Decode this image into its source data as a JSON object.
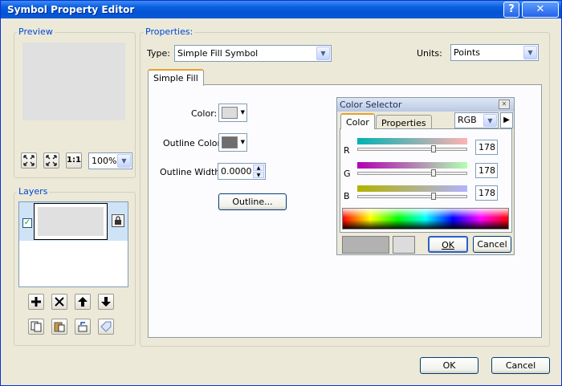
{
  "window": {
    "title": "Symbol Property Editor",
    "help_label": "?",
    "close_label": "✕"
  },
  "preview": {
    "label": "Preview",
    "zoom_value": "100%",
    "swatch_color": "#e0e0e0",
    "icons": [
      "fit-icon",
      "full-extent-icon",
      "actual-size-icon"
    ]
  },
  "layers": {
    "label": "Layers",
    "checked": true,
    "layer_fill": "#e0e0e0",
    "icons_row1": [
      "add-layer-icon",
      "remove-layer-icon",
      "move-up-icon",
      "move-down-icon"
    ],
    "icons_row2": [
      "copy-icon",
      "paste-icon",
      "reset-icon",
      "tag-icon"
    ]
  },
  "properties": {
    "label": "Properties:",
    "type_label": "Type:",
    "type_value": "Simple Fill Symbol",
    "units_label": "Units:",
    "units_value": "Points",
    "tab_label": "Simple Fill",
    "color_label": "Color:",
    "color_value": "#dcdcdc",
    "outline_color_label": "Outline Color:",
    "outline_color_value": "#6e6e6e",
    "outline_width_label": "Outline Width:",
    "outline_width_value": "0.0000",
    "outline_button": "Outline..."
  },
  "color_selector": {
    "title": "Color Selector",
    "tabs": [
      "Color",
      "Properties"
    ],
    "model": "RGB",
    "channels": [
      {
        "name": "R",
        "value": "178",
        "level": 0.7,
        "gradient": "linear-gradient(to right, #00b2b2, #ffb2b2)"
      },
      {
        "name": "G",
        "value": "178",
        "level": 0.7,
        "gradient": "linear-gradient(to right, #b200b2, #b2ffb2)"
      },
      {
        "name": "B",
        "value": "178",
        "level": 0.7,
        "gradient": "linear-gradient(to right, #b2b200, #b2b2ff)"
      }
    ],
    "current_color": "#b2b2b2",
    "previous_color": "#dcdcdc",
    "ok_label": "OK",
    "cancel_label": "Cancel"
  },
  "footer": {
    "ok_label": "OK",
    "cancel_label": "Cancel"
  }
}
